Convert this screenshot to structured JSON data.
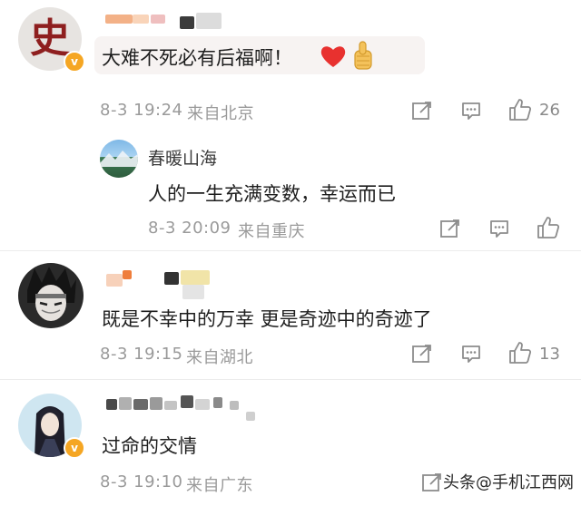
{
  "comments": [
    {
      "text": "大难不死必有后福啊！",
      "time": "8-3 19:24",
      "location": "来自北京",
      "likes": "26",
      "avatar_char": "史",
      "has_v_badge": true,
      "emojis": [
        "heart-emoji",
        "thumbs-up-emoji"
      ]
    },
    {
      "username": "春暖山海",
      "text": "人的一生充满变数，幸运而已",
      "time": "8-3 20:09",
      "location": "来自重庆",
      "likes": ""
    },
    {
      "text": "既是不幸中的万幸 更是奇迹中的奇迹了",
      "time": "8-3 19:15",
      "location": "来自湖北",
      "likes": "13",
      "has_v_badge": false
    },
    {
      "text": "过命的交情",
      "time": "8-3 19:10",
      "location": "来自广东",
      "likes": "",
      "has_v_badge": true
    }
  ],
  "badge_letter": "v",
  "watermark": {
    "prefix": "头条",
    "handle": "@手机江西网"
  },
  "colors": {
    "badge": "#f5a623",
    "meta_text": "#9a9a9a",
    "icon_stroke": "#8c8c8c"
  }
}
